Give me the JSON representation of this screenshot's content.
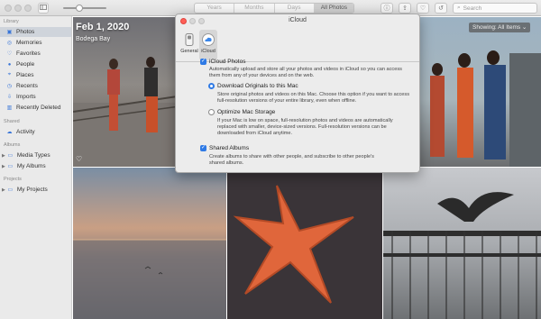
{
  "toolbar": {
    "segments": [
      "Years",
      "Months",
      "Days",
      "All Photos"
    ],
    "active_segment": "All Photos",
    "search_placeholder": "Search",
    "zoom_level": 0.35
  },
  "sidebar": {
    "library_header": "Library",
    "library_items": [
      {
        "label": "Photos",
        "icon": "photos-icon",
        "selected": true
      },
      {
        "label": "Memories",
        "icon": "memories-icon"
      },
      {
        "label": "Favorites",
        "icon": "heart-icon"
      },
      {
        "label": "People",
        "icon": "people-icon"
      },
      {
        "label": "Places",
        "icon": "map-pin-icon"
      },
      {
        "label": "Recents",
        "icon": "clock-icon"
      },
      {
        "label": "Imports",
        "icon": "import-icon"
      },
      {
        "label": "Recently Deleted",
        "icon": "trash-icon"
      }
    ],
    "shared_header": "Shared",
    "shared_items": [
      {
        "label": "Activity",
        "icon": "cloud-icon"
      }
    ],
    "albums_header": "Albums",
    "album_items": [
      {
        "label": "Media Types",
        "icon": "folder-icon"
      },
      {
        "label": "My Albums",
        "icon": "folder-icon"
      }
    ],
    "projects_header": "Projects",
    "project_items": [
      {
        "label": "My Projects",
        "icon": "folder-icon"
      }
    ]
  },
  "main": {
    "date_title": "Feb 1, 2020",
    "location": "Bodega Bay",
    "showing_label": "Showing: All Items"
  },
  "dialog": {
    "title": "iCloud",
    "tabs": [
      {
        "label": "General",
        "icon": "general-switch-icon"
      },
      {
        "label": "iCloud",
        "icon": "icloud-icon",
        "selected": true
      }
    ],
    "icloud_photos": {
      "label": "iCloud Photos",
      "checked": true,
      "description": "Automatically upload and store all your photos and videos in iCloud so you can access them from any of your devices and on the web."
    },
    "download_originals": {
      "label": "Download Originals to this Mac",
      "selected": true,
      "description": "Store original photos and videos on this Mac. Choose this option if you want to access full-resolution versions of your entire library, even when offline."
    },
    "optimize_storage": {
      "label": "Optimize Mac Storage",
      "selected": false,
      "description": "If your Mac is low on space, full-resolution photos and videos are automatically replaced with smaller, device-sized versions. Full-resolution versions can be downloaded from iCloud anytime."
    },
    "shared_albums": {
      "label": "Shared Albums",
      "checked": true,
      "description": "Create albums to share with other people, and subscribe to other people's shared albums."
    }
  },
  "colors": {
    "accent": "#2f7ae5",
    "sidebar_bg": "#eaeaea",
    "dialog_bg": "#ececec"
  }
}
